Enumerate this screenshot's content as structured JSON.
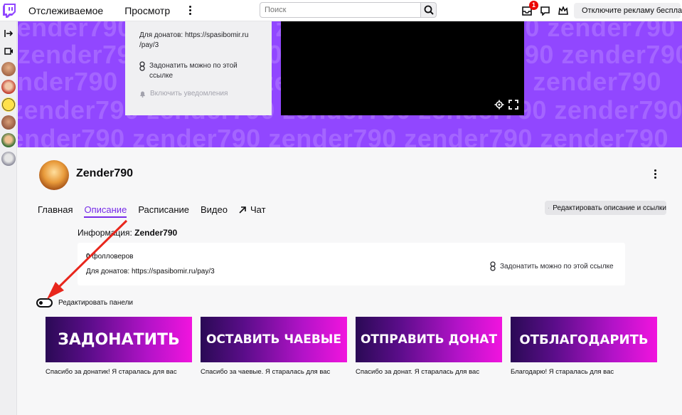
{
  "nav": {
    "following": "Отслеживаемое",
    "browse": "Просмотр",
    "search_placeholder": "Поиск",
    "notifications_count": "1",
    "ad_free": "Отключите рекламу бесплатно"
  },
  "banner": {
    "watermark": "zender790 zender790 zender790 zender790 zender790",
    "donation_text_line1": "Для донатов: https://spasibomir.ru",
    "donation_text_line2": "/pay/3",
    "donate_link": "Задонатить можно по этой ссылке",
    "notify": "Включить уведомления"
  },
  "channel": {
    "name": "Zender790",
    "tabs": [
      "Главная",
      "Описание",
      "Расписание",
      "Видео",
      "Чат"
    ],
    "active_tab": "Описание",
    "edit_button": "Редактировать описание и ссылки"
  },
  "about": {
    "title_prefix": "Информация: ",
    "title_name": "Zender790",
    "followers_count": "0",
    "followers_label": " фолловеров",
    "donations": "Для донатов: https://spasibomir.ru/pay/3",
    "donate_link": "Задонатить можно по этой ссылке"
  },
  "edit_panels": {
    "label": "Редактировать панели",
    "enabled": false
  },
  "panels": [
    {
      "title": "ЗАДОНАТИТЬ",
      "caption": "Спасибо за донатик! Я старалась для вас"
    },
    {
      "title": "ОСТАВИТЬ ЧАЕВЫЕ",
      "caption": "Спасибо за чаевые. Я старалась для вас"
    },
    {
      "title": "ОТПРАВИТЬ ДОНАТ",
      "caption": "Спасибо за донат. Я старалась для вас"
    },
    {
      "title": "ОТБЛАГОДАРИТЬ",
      "caption": "Благодарю! Я старалась для вас"
    }
  ],
  "colors": {
    "brand": "#9147ff",
    "accent": "#772ce8",
    "annotation_arrow": "#e8261c"
  }
}
